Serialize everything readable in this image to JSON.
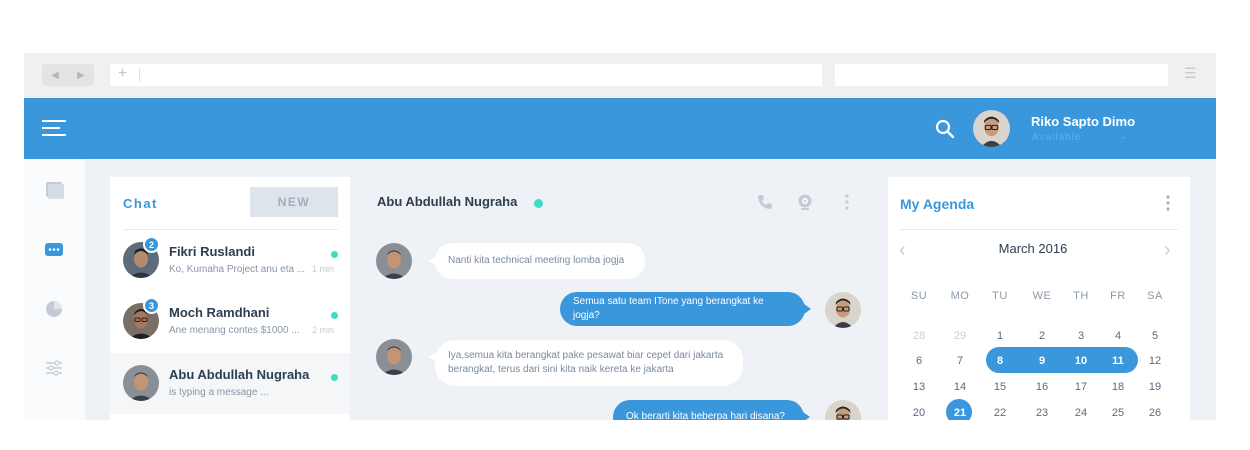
{
  "header": {
    "user_name": "Riko Sapto Dimo",
    "user_status": "Available"
  },
  "chat": {
    "title": "Chat",
    "new_label": "NEW",
    "items": [
      {
        "name": "Fikri Ruslandi",
        "preview": "Ko, Kumaha Project anu eta ...",
        "time": "1 min",
        "badge": "2"
      },
      {
        "name": "Moch Ramdhani",
        "preview": "Ane menang contes $1000 ...",
        "time": "2 min",
        "badge": "3"
      },
      {
        "name": "Abu Abdullah Nugraha",
        "preview": "is typing a message ...",
        "time": "",
        "badge": ""
      }
    ]
  },
  "conversation": {
    "contact_name": "Abu Abdullah Nugraha",
    "messages": [
      {
        "direction": "in",
        "text": "Nanti  kita technical meeting lomba jogja"
      },
      {
        "direction": "out",
        "text": "Semua satu team ITone yang berangkat ke jogja?"
      },
      {
        "direction": "in",
        "text": "Iya,semua kita berangkat pake pesawat biar cepet dari  jakarta berangkat, terus dari sini kita naik kereta ke jakarta"
      },
      {
        "direction": "out",
        "text": "Ok berarti kita beberpa hari disana?"
      }
    ]
  },
  "agenda": {
    "title": "My Agenda",
    "month": "March 2016",
    "weekdays": [
      "SU",
      "MO",
      "TU",
      "WE",
      "TH",
      "FR",
      "SA"
    ],
    "weeks": [
      [
        "28",
        "29",
        "1",
        "2",
        "3",
        "4",
        "5"
      ],
      [
        "6",
        "7",
        "8",
        "9",
        "10",
        "11",
        "12"
      ],
      [
        "13",
        "14",
        "15",
        "16",
        "17",
        "18",
        "19"
      ],
      [
        "20",
        "21",
        "22",
        "23",
        "24",
        "25",
        "26"
      ]
    ],
    "selected_range": [
      "8",
      "9",
      "10",
      "11"
    ],
    "today": "21"
  },
  "colors": {
    "accent": "#3a97dc",
    "online": "#3fdcc4"
  },
  "icons": {
    "browser": [
      "back-arrow-icon",
      "forward-arrow-icon",
      "new-tab-plus-icon",
      "browser-menu-icon"
    ],
    "header": [
      "hamburger-menu-icon",
      "search-icon"
    ],
    "sidebar": [
      "inbox-icon",
      "chat-bubble-icon",
      "pie-chart-icon",
      "sliders-icon"
    ],
    "conversation": [
      "phone-icon",
      "webcam-icon",
      "kebab-menu-icon"
    ]
  }
}
